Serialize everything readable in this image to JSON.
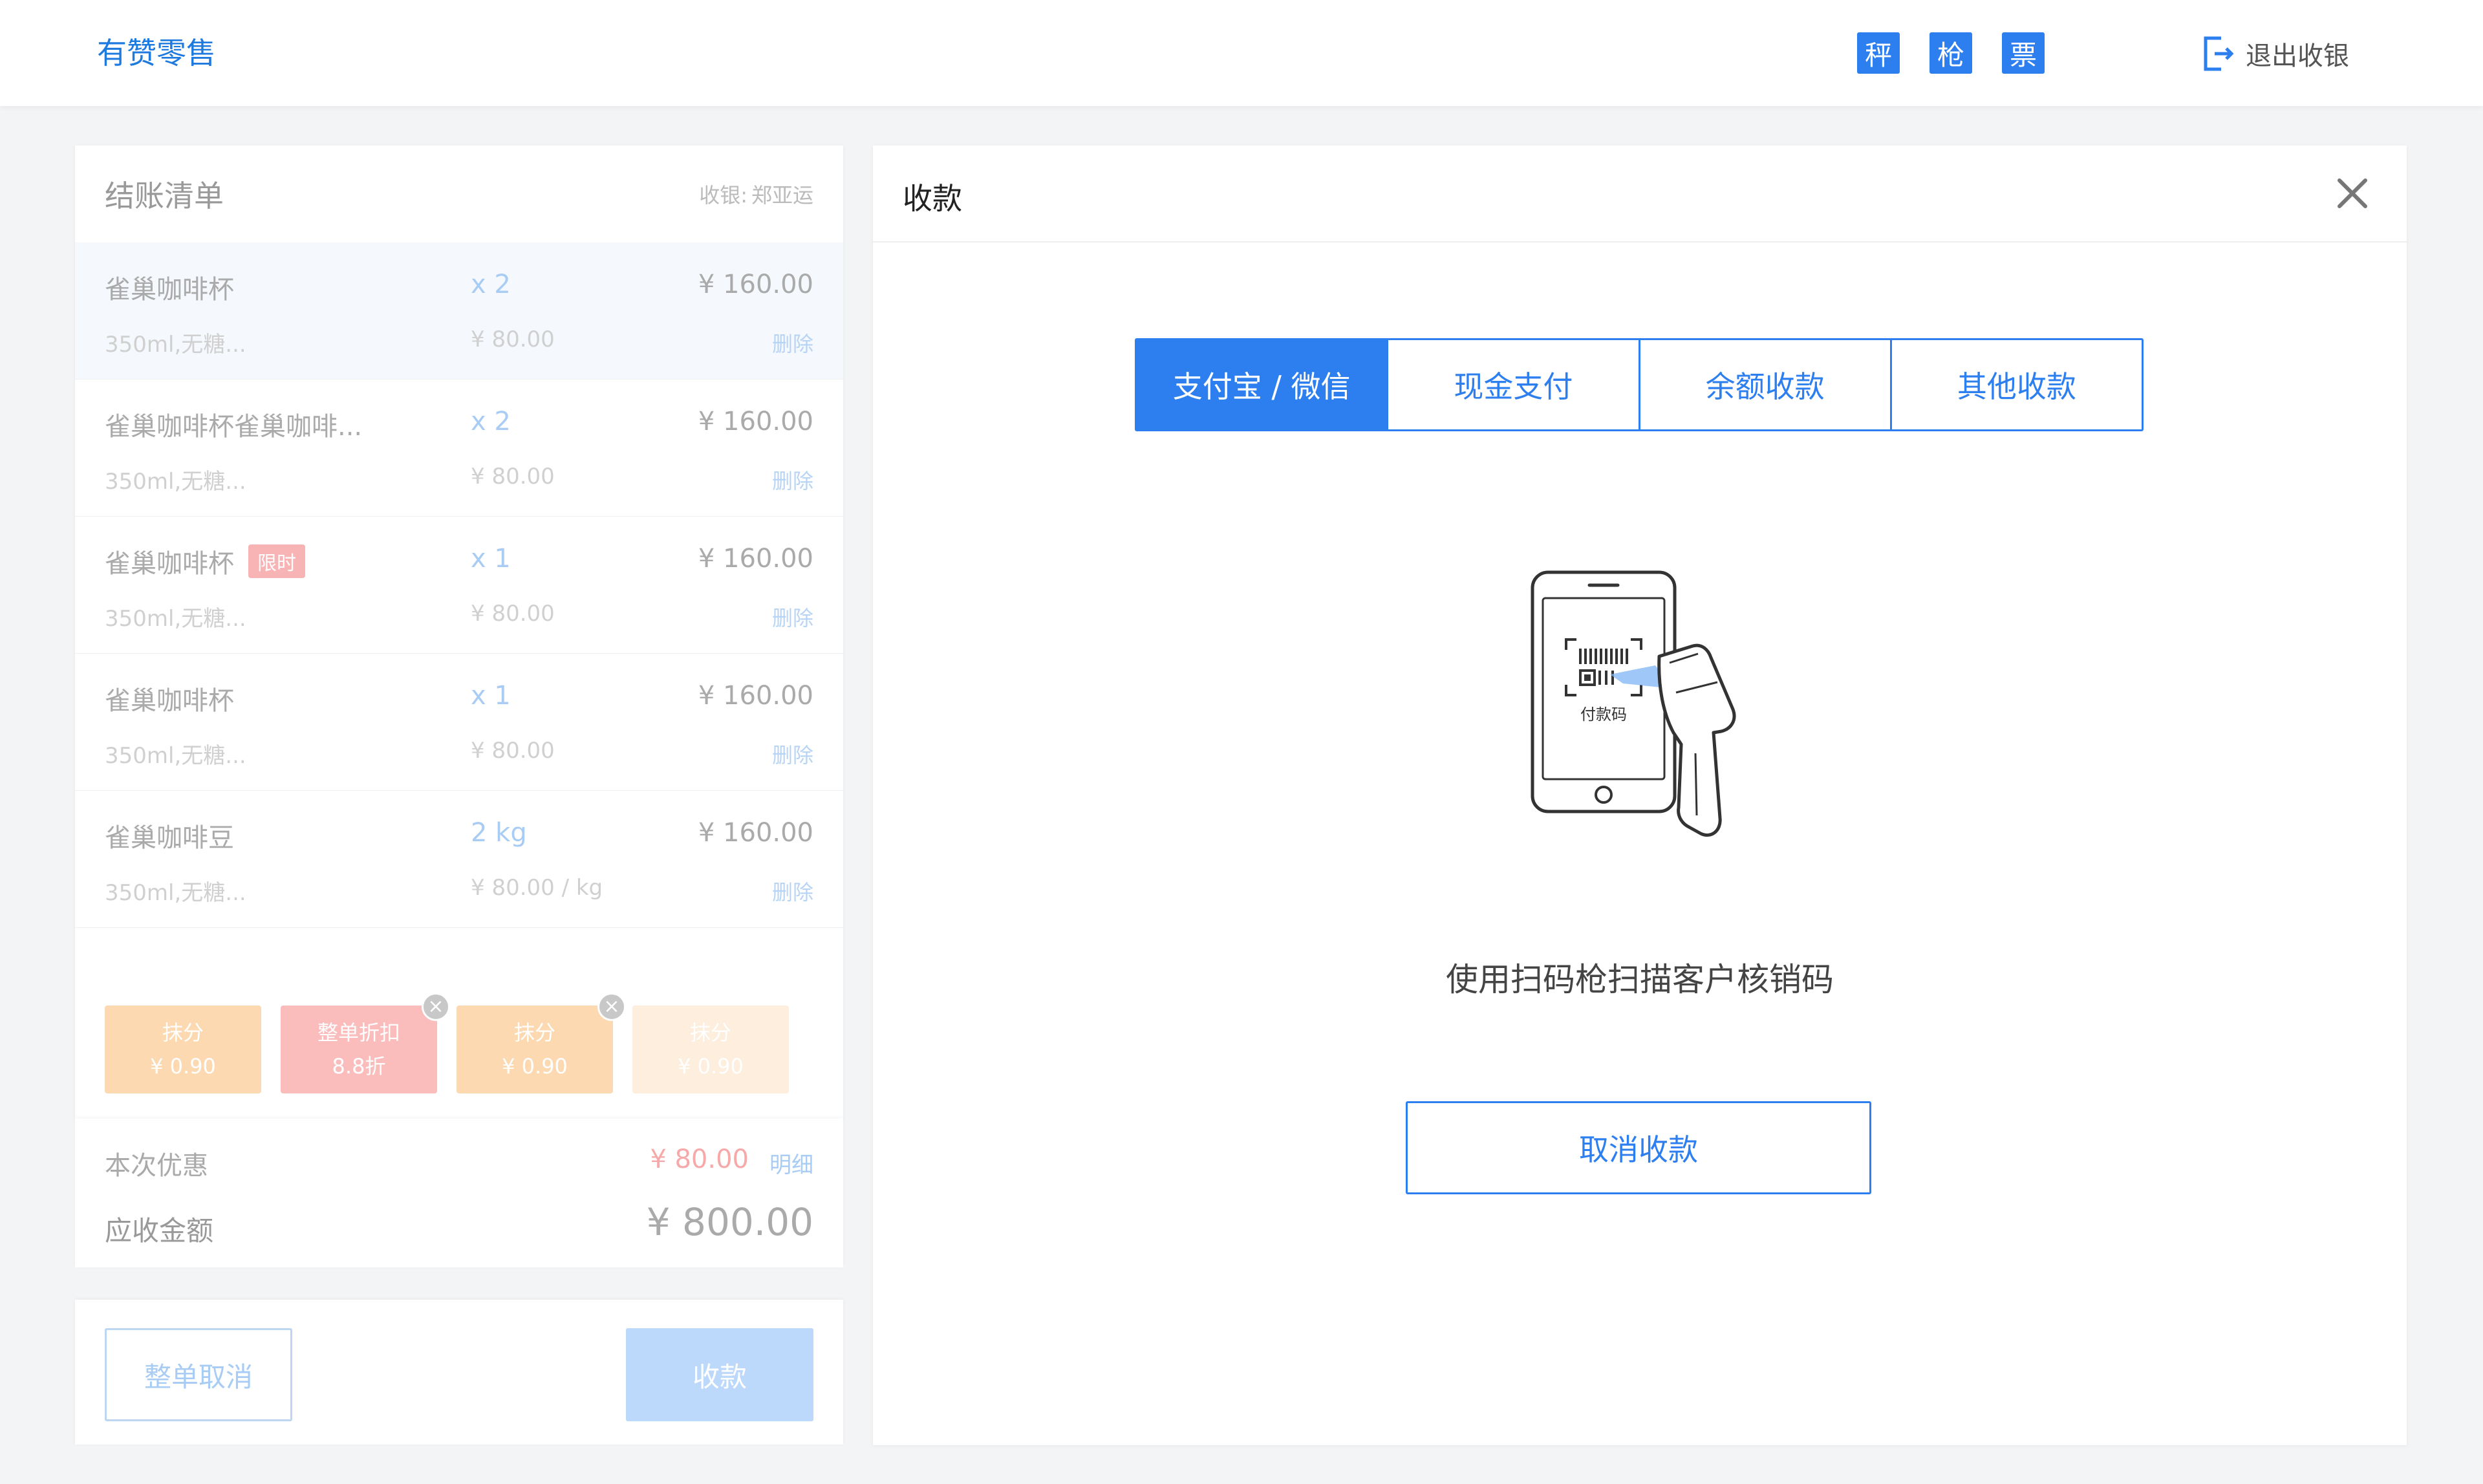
{
  "topbar": {
    "brand": "有赞零售",
    "hardware": [
      {
        "label": "秤"
      },
      {
        "label": "枪"
      },
      {
        "label": "票"
      }
    ],
    "logout_label": "退出收银"
  },
  "bill": {
    "title": "结账清单",
    "cashier_label": "收银:",
    "cashier_name": "郑亚运",
    "items": [
      {
        "name": "雀巢咖啡杯",
        "tag": "",
        "qty": "x 2",
        "total": "¥ 160.00",
        "spec": "350ml,无糖...",
        "unit_price": "¥ 80.00",
        "delete": "删除"
      },
      {
        "name": "雀巢咖啡杯雀巢咖啡...",
        "tag": "",
        "qty": "x 2",
        "total": "¥ 160.00",
        "spec": "350ml,无糖...",
        "unit_price": "¥ 80.00",
        "delete": "删除"
      },
      {
        "name": "雀巢咖啡杯",
        "tag": "限时",
        "qty": "x 1",
        "total": "¥ 160.00",
        "spec": "350ml,无糖...",
        "unit_price": "¥ 80.00",
        "delete": "删除"
      },
      {
        "name": "雀巢咖啡杯",
        "tag": "",
        "qty": "x 1",
        "total": "¥ 160.00",
        "spec": "350ml,无糖...",
        "unit_price": "¥ 80.00",
        "delete": "删除"
      },
      {
        "name": "雀巢咖啡豆",
        "tag": "",
        "qty": "2 kg",
        "total": "¥ 160.00",
        "spec": "350ml,无糖...",
        "unit_price": "¥ 80.00 / kg",
        "delete": "删除"
      }
    ],
    "discounts": [
      {
        "label": "抹分",
        "value": "¥ 0.90"
      },
      {
        "label": "整单折扣",
        "value": "8.8折"
      },
      {
        "label": "抹分",
        "value": "¥ 0.90"
      },
      {
        "label": "抹分",
        "value": "¥ 0.90"
      }
    ],
    "discount_label": "本次优惠",
    "discount_amount": "¥ 80.00",
    "detail_link": "明细",
    "receivable_label": "应收金额",
    "receivable_amount": "¥ 800.00",
    "cancel_all": "整单取消",
    "collect": "收款"
  },
  "payment": {
    "title": "收款",
    "tabs": [
      {
        "label": "支付宝 / 微信"
      },
      {
        "label": "现金支付"
      },
      {
        "label": "余额收款"
      },
      {
        "label": "其他收款"
      }
    ],
    "active_tab": 0,
    "code_label": "付款码",
    "hint": "使用扫码枪扫描客户核销码",
    "cancel_label": "取消收款"
  },
  "colors": {
    "accent": "#2d7ff0",
    "brand": "#1f7ae0"
  }
}
